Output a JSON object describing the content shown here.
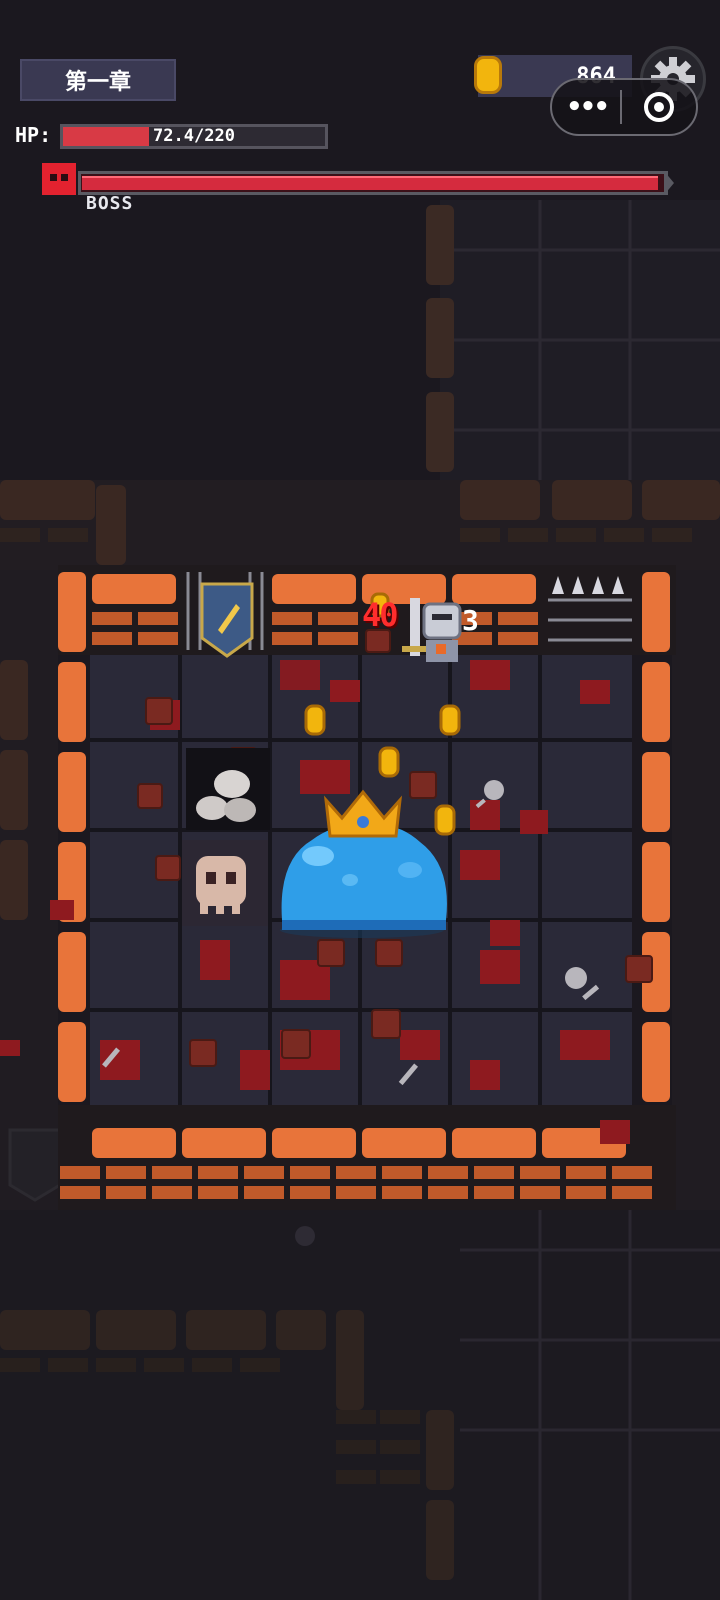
{
  "hud": {
    "chapter_title": "第一章",
    "coins": "864",
    "hp_label": "HP:",
    "hp_text": "72.4/220",
    "hp_fraction": 0.33,
    "boss_label": "BOSS",
    "boss_hp_fraction": 0.99
  },
  "combat": {
    "damage_number": "40",
    "hit_number": "3"
  },
  "icons": {
    "coin": "coin-icon",
    "settings": "gear-icon",
    "menu": "more-dots-icon",
    "close": "close-circle-icon",
    "boss": "red-skull-icon"
  },
  "colors": {
    "background": "#1b181f",
    "wall_orange": "#e8743a",
    "floor": "#2a2938",
    "hp_red": "#d83a45",
    "boss_red": "#d52b3e",
    "slime_blue": "#2f9ee8",
    "crown_gold": "#f2a818",
    "coin_gold": "#f2b50d"
  }
}
